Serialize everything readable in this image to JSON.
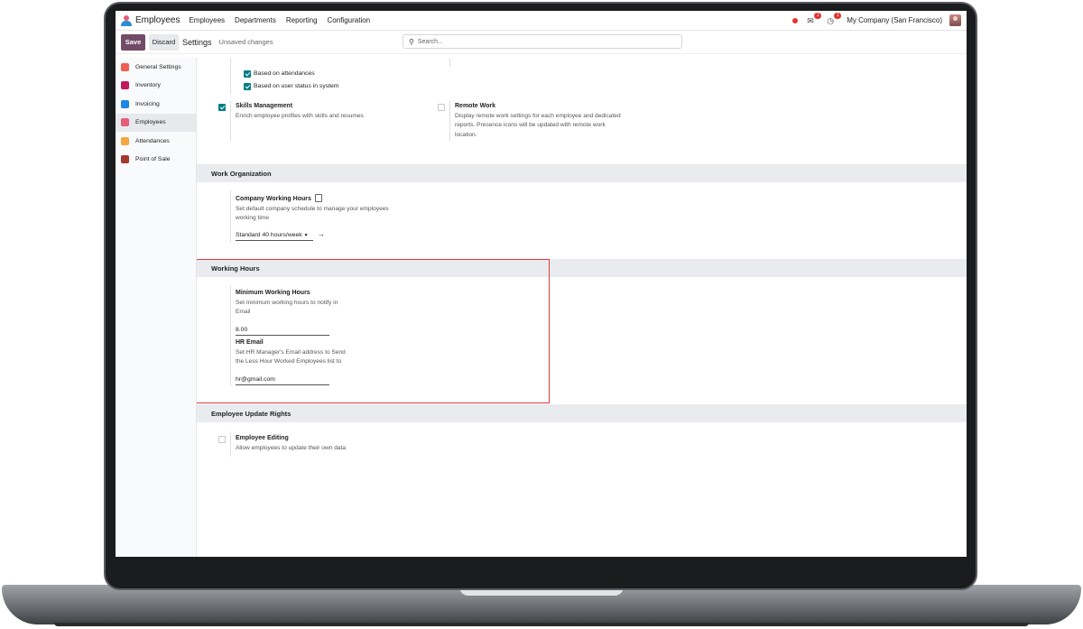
{
  "navbar": {
    "app_name": "Employees",
    "menu": [
      "Employees",
      "Departments",
      "Reporting",
      "Configuration"
    ],
    "messages_badge": "1",
    "activities_badge": "1",
    "company": "My Company (San Francisco)"
  },
  "control": {
    "save_label": "Save",
    "discard_label": "Discard",
    "breadcrumb": "Settings",
    "status": "Unsaved changes",
    "search_placeholder": "Search..."
  },
  "sidebar": {
    "items": [
      {
        "label": "General Settings",
        "color": "#f06050"
      },
      {
        "label": "Inventory",
        "color": "#c2185b"
      },
      {
        "label": "Invoicing",
        "color": "#1e88e5"
      },
      {
        "label": "Employees",
        "color": "#e45d7a"
      },
      {
        "label": "Attendances",
        "color": "#f4a742"
      },
      {
        "label": "Point of Sale",
        "color": "#a2392f"
      }
    ],
    "active_index": 3
  },
  "top_checkboxes": {
    "attendance": "Based on attendances",
    "user_status": "Based on user status in system"
  },
  "skills": {
    "title": "Skills Management",
    "desc": "Enrich employee profiles with skills and resumes",
    "checked": true
  },
  "remote": {
    "title": "Remote Work",
    "desc1": "Display remote work settings for each employee and dedicated",
    "desc2": "reports. Presence icons will be updated with remote work",
    "desc3": "location.",
    "checked": false
  },
  "work_org": {
    "header": "Work Organization",
    "title": "Company Working Hours",
    "desc1": "Set default company schedule to manage your employees",
    "desc2": "working time",
    "value": "Standard 40 hours/week"
  },
  "working_hours": {
    "header": "Working Hours",
    "min_title": "Minimum Working Hours",
    "min_desc1": "Set minimum working hours to notify in",
    "min_desc2": "Email",
    "min_value": "8.00",
    "email_title": "HR Email",
    "email_desc1": "Set HR Manager's Email address to Send",
    "email_desc2": "the Less Hour Worked Employees list to",
    "email_value": "hr@gmail.com"
  },
  "update_rights": {
    "header": "Employee Update Rights",
    "title": "Employee Editing",
    "desc": "Allow employees to update their own data",
    "checked": false
  }
}
